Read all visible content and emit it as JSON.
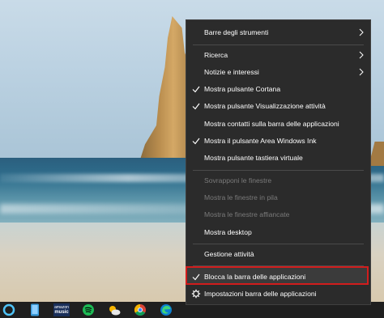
{
  "context_menu": {
    "items": [
      {
        "label": "Barre degli strumenti",
        "checked": false,
        "disabled": false,
        "submenu": true
      },
      {
        "label": "Ricerca",
        "checked": false,
        "disabled": false,
        "submenu": true
      },
      {
        "label": "Notizie e interessi",
        "checked": false,
        "disabled": false,
        "submenu": true
      },
      {
        "label": "Mostra pulsante Cortana",
        "checked": true,
        "disabled": false,
        "submenu": false
      },
      {
        "label": "Mostra pulsante Visualizzazione attività",
        "checked": true,
        "disabled": false,
        "submenu": false
      },
      {
        "label": "Mostra contatti sulla barra delle applicazioni",
        "checked": false,
        "disabled": false,
        "submenu": false
      },
      {
        "label": "Mostra il pulsante Area Windows Ink",
        "checked": true,
        "disabled": false,
        "submenu": false
      },
      {
        "label": "Mostra pulsante tastiera virtuale",
        "checked": false,
        "disabled": false,
        "submenu": false
      },
      {
        "label": "Sovrapponi le finestre",
        "checked": false,
        "disabled": true,
        "submenu": false
      },
      {
        "label": "Mostra le finestre in pila",
        "checked": false,
        "disabled": true,
        "submenu": false
      },
      {
        "label": "Mostra le finestre affiancate",
        "checked": false,
        "disabled": true,
        "submenu": false
      },
      {
        "label": "Mostra desktop",
        "checked": false,
        "disabled": false,
        "submenu": false
      },
      {
        "label": "Gestione attività",
        "checked": false,
        "disabled": false,
        "submenu": false
      },
      {
        "label": "Blocca la barra delle applicazioni",
        "checked": true,
        "disabled": false,
        "submenu": false,
        "highlighted": true
      },
      {
        "label": "Impostazioni barra delle applicazioni",
        "checked": false,
        "disabled": false,
        "submenu": false,
        "icon": "gear-icon"
      }
    ]
  },
  "taskbar": {
    "apps": [
      {
        "name": "cortana-icon"
      },
      {
        "name": "phone-app-icon"
      },
      {
        "name": "amazon-music-icon",
        "text_top": "amazon",
        "text_bottom": "music"
      },
      {
        "name": "spotify-icon"
      },
      {
        "name": "weather-icon"
      },
      {
        "name": "chrome-icon"
      },
      {
        "name": "edge-icon"
      }
    ]
  },
  "colors": {
    "menu_bg": "#2b2b2b",
    "menu_text": "#ffffff",
    "menu_disabled_text": "#7a7a7a",
    "highlight_border": "#d11d1d",
    "taskbar_bg": "#1f1f1f"
  }
}
